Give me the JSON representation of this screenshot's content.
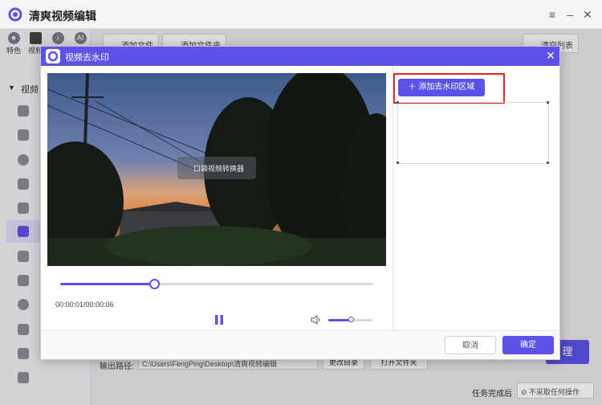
{
  "app": {
    "title": "清爽视频编辑"
  },
  "sidebar": {
    "tabs": [
      {
        "label": "特色",
        "icon": "star-icon"
      },
      {
        "label": "视频",
        "icon": "video-icon"
      },
      {
        "label": "",
        "icon": "music-icon"
      },
      {
        "label": "",
        "icon": "ai-icon"
      }
    ],
    "section_label": "视频"
  },
  "toolbar": {
    "add_file": "添加文件",
    "add_folder": "添加文件夹",
    "clear_list": "清空列表"
  },
  "dialog": {
    "title": "视频去水印",
    "add_watermark_area": "添加去水印区域",
    "time": "00:00:01/00:00:06",
    "progress": 0.3,
    "volume": 0.5,
    "watermark_text": "口袋视频转换器",
    "cancel": "取消",
    "confirm": "确定"
  },
  "footer": {
    "output_label": "输出路径:",
    "output_path": "C:\\Users\\FengPing\\Desktop\\清爽视频编辑",
    "change_dir": "更改目录",
    "open_folder": "打开文件夹",
    "after_complete_label": "任务完成后",
    "after_complete_value": "不采取任何操作"
  },
  "colors": {
    "accent": "#5d51e8",
    "highlight": "#e0262a"
  }
}
